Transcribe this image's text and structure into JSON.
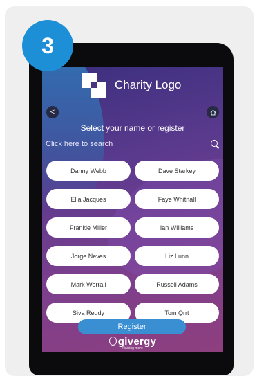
{
  "step": {
    "number": "3"
  },
  "app": {
    "logo_text": "Charity Logo",
    "back_label": "<",
    "prompt": "Select your name or register",
    "search_placeholder": "Click here to search"
  },
  "names": [
    "Danny Webb",
    "Dave Starkey",
    "Ella Jacques",
    "Faye Whitnall",
    "Frankie Miller",
    "Ian Williams",
    "Jorge Neves",
    "Liz Lunn",
    "Mark Worrall",
    "Russell Adams",
    "Siva Reddy",
    "Tom Qrrt"
  ],
  "footer": {
    "register_label": "Register",
    "brand_name": "givergy",
    "brand_tagline": "Raising more"
  },
  "colors": {
    "accent": "#1d8fd6",
    "register": "#3a8fd3",
    "screen_bg": "#5b3a8e"
  },
  "icons": [
    "back-icon",
    "home-icon",
    "search-icon",
    "charity-logo-mark",
    "givergy-logo-icon"
  ]
}
